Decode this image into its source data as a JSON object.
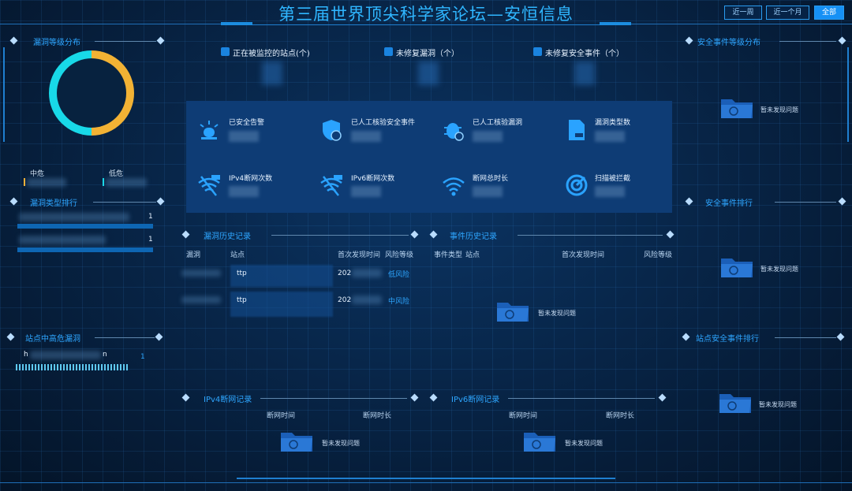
{
  "header": {
    "title": "第三届世界顶尖科学家论坛—安恒信息",
    "period_buttons": [
      {
        "label": "近一周",
        "active": false
      },
      {
        "label": "近一个月",
        "active": false
      },
      {
        "label": "全部",
        "active": true
      }
    ]
  },
  "sections": {
    "vuln_level_dist": "漏洞等级分布",
    "vuln_type_rank": "漏洞类型排行",
    "site_high_vuln": "站点中高危漏洞",
    "vuln_history": "漏洞历史记录",
    "event_history": "事件历史记录",
    "ipv4_outage": "IPv4断网记录",
    "ipv6_outage": "IPv6断网记录",
    "sec_event_level_dist": "安全事件等级分布",
    "sec_event_rank": "安全事件排行",
    "site_sec_event_rank": "站点安全事件排行"
  },
  "donut": {
    "legend": [
      {
        "label": "中危",
        "color": "#f2b234"
      },
      {
        "label": "低危",
        "color": "#18d9e8"
      }
    ],
    "values": [
      0.5,
      0.5
    ]
  },
  "vuln_type_rank": {
    "rows": [
      {
        "count": "1"
      },
      {
        "count": "1"
      }
    ]
  },
  "site_high_vuln": {
    "site_prefix": "h",
    "site_suffix": "n",
    "count": "1"
  },
  "stats": [
    {
      "label": "正在被监控的站点(个)",
      "icon": "monitor-icon"
    },
    {
      "label": "未修复漏洞（个）",
      "icon": "vuln-icon"
    },
    {
      "label": "未修复安全事件（个）",
      "icon": "event-icon"
    }
  ],
  "panel_items": [
    {
      "label": "已安全告警",
      "icon": "alarm-icon"
    },
    {
      "label": "已人工核验安全事件",
      "icon": "shield-event-icon"
    },
    {
      "label": "已人工核验漏洞",
      "icon": "bug-icon"
    },
    {
      "label": "漏洞类型数",
      "icon": "document-icon"
    },
    {
      "label": "IPv4断网次数",
      "icon": "ipv4-no-wifi-icon"
    },
    {
      "label": "IPv6断网次数",
      "icon": "ipv6-no-wifi-icon"
    },
    {
      "label": "断网总时长",
      "icon": "wifi-icon"
    },
    {
      "label": "扫描被拦截",
      "icon": "scan-block-icon"
    }
  ],
  "vuln_history": {
    "columns": [
      "漏洞",
      "站点",
      "首次发现时间",
      "风险等级"
    ],
    "rows": [
      {
        "site_prefix": "ttp",
        "time_prefix": "202",
        "risk": "低风险"
      },
      {
        "site_prefix": "ttp",
        "time_prefix": "202",
        "risk": "中风险"
      }
    ]
  },
  "event_history": {
    "columns": [
      "事件类型",
      "站点",
      "首次发现时间",
      "风险等级"
    ]
  },
  "outage": {
    "columns": [
      "断网时间",
      "断网时长"
    ]
  },
  "empty_text": "暂未发现问题",
  "colors": {
    "accent": "#2ea6ff",
    "panel": "#0e3c75",
    "medium": "#f2b234",
    "low": "#18d9e8"
  }
}
